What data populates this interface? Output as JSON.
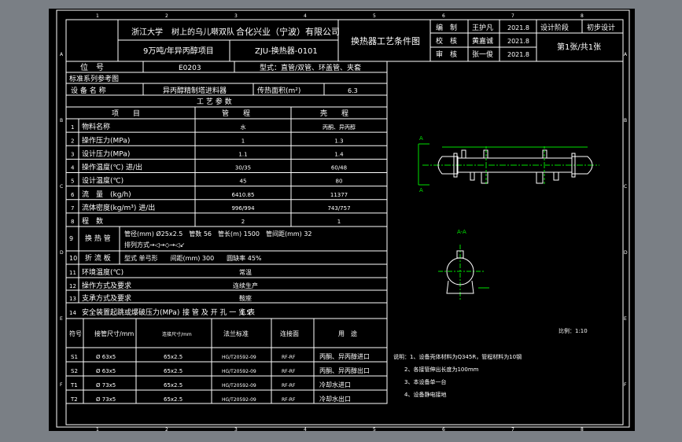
{
  "title_block": {
    "university": "浙江大学",
    "team": "树上的乌儿啭双队",
    "company": "合化兴业（宁波）有限公司",
    "project": "9万吨/年异丙醇项目",
    "drawing_no": "ZJU-换热器-0101",
    "drawing_title": "换热器工艺条件图",
    "rows": [
      {
        "role": "编　制",
        "name": "王护凡",
        "date": "2021.8"
      },
      {
        "role": "校　核",
        "name": "黄嘉诚",
        "date": "2021.8"
      },
      {
        "role": "审　核",
        "name": "张一俊",
        "date": "2021.8"
      }
    ],
    "stage_label": "设计阶段",
    "stage_value": "初步设计",
    "sheet": "第1张/共1张"
  },
  "border_letters": [
    "A",
    "B",
    "C",
    "D",
    "E",
    "F"
  ],
  "border_numbers": [
    "1",
    "2",
    "3",
    "4",
    "5",
    "6",
    "7",
    "8"
  ],
  "spec": {
    "tag_label": "位　号",
    "tag_value": "E0203",
    "type_label": "型式：直管/双管、环盖管、夹套",
    "std_ref": "标准系列参考图",
    "equip_name_label": "设 备 名 称",
    "equip_name_value": "异丙醇精制塔进料器",
    "area_label": "传热面积(m²)",
    "area_value": "6.3",
    "process_params": "工 艺 参 数",
    "col_item": "项　　目",
    "col_tube": "管　　程",
    "col_shell": "壳　　程",
    "rows": [
      {
        "no": "1",
        "name": "物料名称",
        "tube": "水",
        "shell": "丙酮、异丙醇"
      },
      {
        "no": "2",
        "name": "操作压力(MPa)",
        "tube": "1",
        "shell": "1.3"
      },
      {
        "no": "3",
        "name": "设计压力(MPa)",
        "tube": "1.1",
        "shell": "1.4"
      },
      {
        "no": "4",
        "name": "操作温度(℃) 进/出",
        "tube": "30/35",
        "shell": "60/48"
      },
      {
        "no": "5",
        "name": "设计温度(℃)",
        "tube": "45",
        "shell": "80"
      },
      {
        "no": "6",
        "name": "流　量　(kg/h)",
        "tube": "6410.85",
        "shell": "11377"
      },
      {
        "no": "7",
        "name": "流体密度(kg/m³) 进/出",
        "tube": "996/994",
        "shell": "743/757"
      },
      {
        "no": "8",
        "name": "程　数",
        "tube": "2",
        "shell": "1"
      }
    ],
    "row9_no": "9",
    "row9_label": "换 热 管",
    "row9_line1": "管径(mm) Ø25x2.5　管数 56　管长(m) 1500　管间距(mm) 32",
    "row9_line2": "排列方式→◁→◇→◁↙",
    "row10_no": "10",
    "row10_label": "折 流 板",
    "row10_value": "型式 单弓形　　间距(mm) 300　　圆缺率 45%",
    "extra_rows": [
      {
        "no": "11",
        "name": "环境温度(℃)",
        "value": "常温"
      },
      {
        "no": "12",
        "name": "操作方式及要求",
        "value": "连续生产"
      },
      {
        "no": "13",
        "name": "支承方式及要求",
        "value": "鞍座"
      },
      {
        "no": "14",
        "name": "安全装置起跳或爆破压力(MPa)",
        "value": "1.5"
      }
    ]
  },
  "nozzle": {
    "title": "接 管 及 开 孔 一 览 表",
    "headers": [
      "符号",
      "接管尺寸/mm",
      "连接尺寸/mm",
      "法兰标准",
      "连接面",
      "用　途"
    ],
    "rows": [
      {
        "sym": "S1",
        "size": "Ø 63x5",
        "conn": "65x2.5",
        "std": "HG/T20592-09",
        "face": "RF-RF",
        "use": "丙酮、异丙醇进口"
      },
      {
        "sym": "S2",
        "size": "Ø 63x5",
        "conn": "65x2.5",
        "std": "HG/T20592-09",
        "face": "RF-RF",
        "use": "丙酮、异丙醇出口"
      },
      {
        "sym": "T1",
        "size": "Ø 73x5",
        "conn": "65x2.5",
        "std": "HG/T20592-09",
        "face": "RF-RF",
        "use": "冷却水进口"
      },
      {
        "sym": "T2",
        "size": "Ø 73x5",
        "conn": "65x2.5",
        "std": "HG/T20592-09",
        "face": "RF-RF",
        "use": "冷却水出口"
      }
    ]
  },
  "drawing": {
    "view_a": "A",
    "section_label": "A-A",
    "scale": "比例：1:10"
  },
  "notes": [
    "说明：1、设备壳体材料为Q345R，管程材料为10钢",
    "2、各接管伸出长度为100mm",
    "3、本设备单一台",
    "4、设备静电接地"
  ]
}
